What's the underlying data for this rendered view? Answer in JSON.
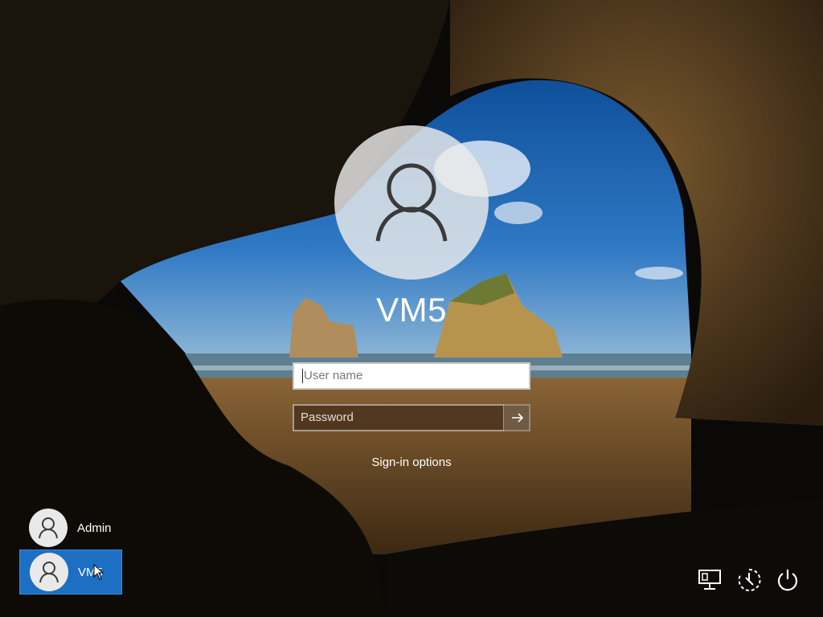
{
  "account": {
    "name": "VM5"
  },
  "form": {
    "username_placeholder": "User name",
    "password_placeholder": "Password",
    "signin_options_label": "Sign-in options"
  },
  "users": [
    {
      "name": "Admin",
      "selected": false
    },
    {
      "name": "VM5",
      "selected": true
    }
  ],
  "icons": {
    "network": "network-icon",
    "accessibility": "ease-of-access-icon",
    "power": "power-icon",
    "submit": "arrow-right-icon",
    "avatar": "user-icon"
  },
  "colors": {
    "selected_tile": "#1c6fc2"
  }
}
